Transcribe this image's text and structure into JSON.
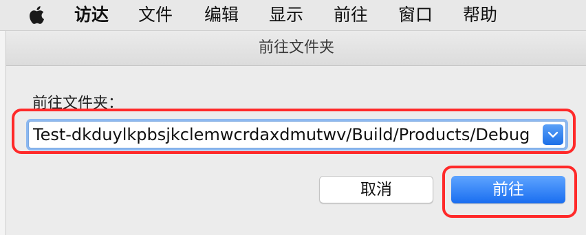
{
  "menubar": {
    "items": [
      "访达",
      "文件",
      "编辑",
      "显示",
      "前往",
      "窗口",
      "帮助"
    ]
  },
  "dialog": {
    "title": "前往文件夹",
    "prompt": "前往文件夹：",
    "path_value": "Test-dkduylkpbsjkclemwcrdaxdmutwv/Build/Products/Debug",
    "cancel_label": "取消",
    "go_label": "前往"
  },
  "colors": {
    "accent": "#1a6ef0",
    "highlight": "#ff2a2a"
  },
  "icons": {
    "apple": "apple-icon",
    "dropdown": "chevron-down-icon"
  }
}
